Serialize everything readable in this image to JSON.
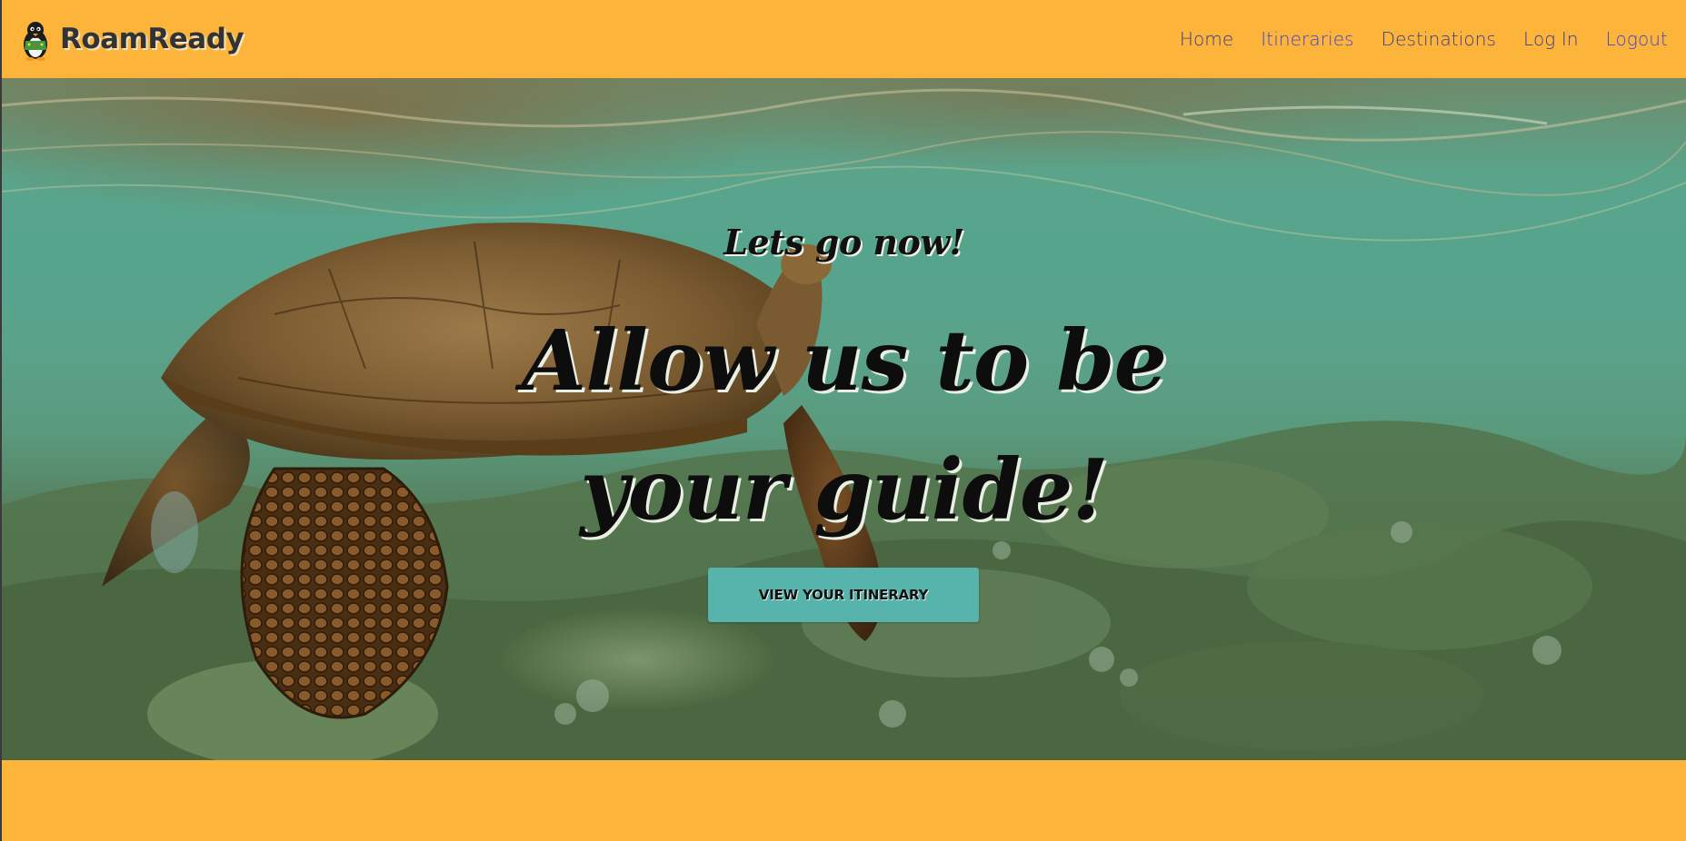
{
  "brand": {
    "name": "RoamReady",
    "logo_icon": "penguin-logo-icon"
  },
  "nav": {
    "items": [
      {
        "label": "Home"
      },
      {
        "label": "Itineraries"
      },
      {
        "label": "Destinations"
      },
      {
        "label": "Log In"
      },
      {
        "label": "Logout"
      }
    ]
  },
  "hero": {
    "tagline": "Lets go now!",
    "headline_line1": "Allow us to be",
    "headline_line2": "your guide!",
    "cta_label": "VIEW YOUR ITINERARY",
    "background_image": "sea-turtle-underwater-photo"
  },
  "colors": {
    "header_bg": "#FCB43A",
    "nav_link": "#3b3b8f",
    "nav_link_highlight": "#3f45d6",
    "cta_bg": "#56B4AC",
    "hero_text": "#0d0d0d"
  }
}
